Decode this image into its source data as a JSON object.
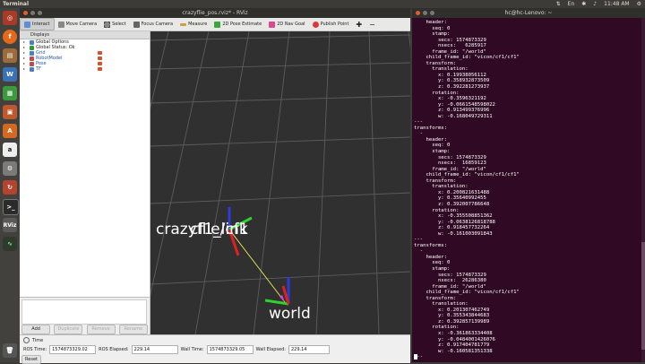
{
  "panel": {
    "app_title": "Terminal",
    "time": "11:48 AM"
  },
  "launcher": {
    "items": [
      "dash",
      "firefox",
      "files",
      "libreoffice-writer",
      "libreoffice-calc",
      "libreoffice-impress",
      "software",
      "amazon",
      "settings",
      "update",
      "terminal",
      "rviz",
      "monitor",
      "trash"
    ]
  },
  "rviz": {
    "title": "crazyflie_pos.rviz* - RViz",
    "toolbar": [
      "Interact",
      "Move Camera",
      "Select",
      "Focus Camera",
      "Measure",
      "2D Pose Estimate",
      "2D Nav Goal",
      "Publish Point"
    ],
    "displays_header": "Displays",
    "displays": [
      {
        "label": "Global Options",
        "checkbox": false,
        "icon_color": "#4a7fc0",
        "style": "normal"
      },
      {
        "label": "Global Status: Ok",
        "checkbox": false,
        "icon_color": "#2f9a2f",
        "style": "normal"
      },
      {
        "label": "Grid",
        "checkbox": true,
        "icon_color": "#4a7fc0",
        "style": "blue"
      },
      {
        "label": "RobotModel",
        "checkbox": true,
        "icon_color": "#c04a4a",
        "style": "blue"
      },
      {
        "label": "Pose",
        "checkbox": true,
        "icon_color": "#c04a4a",
        "style": "blue"
      },
      {
        "label": "TF",
        "checkbox": true,
        "icon_color": "#4a7fc0",
        "style": "blue"
      }
    ],
    "buttons": {
      "add": "Add",
      "duplicate": "Duplicate",
      "remove": "Remove",
      "rename": "Rename"
    },
    "viewport": {
      "frame_labels": {
        "stacked_1": "crazyflie/cf1",
        "stacked_2": "cf1_link",
        "world": "world"
      }
    },
    "time_panel": {
      "header": "Time",
      "ros_time_label": "ROS Time:",
      "ros_time": "1574873329.02",
      "ros_elapsed_label": "ROS Elapsed:",
      "ros_elapsed": "229.14",
      "wall_time_label": "Wall Time:",
      "wall_time": "1574873329.05",
      "wall_elapsed_label": "Wall Elapsed:",
      "wall_elapsed": "229.14",
      "reset": "Reset"
    }
  },
  "terminal": {
    "title": "hc@hc-Lenovo: ~",
    "text": "    header:\n      seq: 0\n      stamp:\n        secs: 1574873329\n        nsecs:   6285917\n      frame_id: \"/world\"\n    child_frame_id: \"vicon/cf1/cf1\"\n    transform:\n      translation:\n        x: 0.19938056112\n        y: 0.358932873509\n        z: 0.392281273937\n      rotation:\n        x: -0.3596321192\n        y: -0.0661548598022\n        z: 0.913499376996\n        w: -0.168049729311\n---\ntransforms:\n  -\n    header:\n      seq: 0\n      stamp:\n        secs: 1574873329\n        nsecs:  16859123\n      frame_id: \"/world\"\n    child_frame_id: \"vicon/cf1/cf1\"\n    transform:\n      translation:\n        x: 0.200821631488\n        y: 0.35640992455\n        z: 0.392007786648\n      rotation:\n        x: -0.355508851362\n        y: -0.0638126818788\n        z: 0.918457732264\n        w: -0.161003091843\n---\ntransforms:\n  -\n    header:\n      seq: 0\n      stamp:\n        secs: 1574873329\n        nsecs:  26286380\n      frame_id: \"/world\"\n    child_frame_id: \"vicon/cf1/cf1\"\n    transform:\n      translation:\n        x: 0.201307462749\n        y: 0.355343844683\n        z: 0.392857139989\n      rotation:\n        x: -0.361863334408\n        y: -0.0484001426076\n        z: 0.917404781779\n        w: -0.160581351338\n---"
  }
}
